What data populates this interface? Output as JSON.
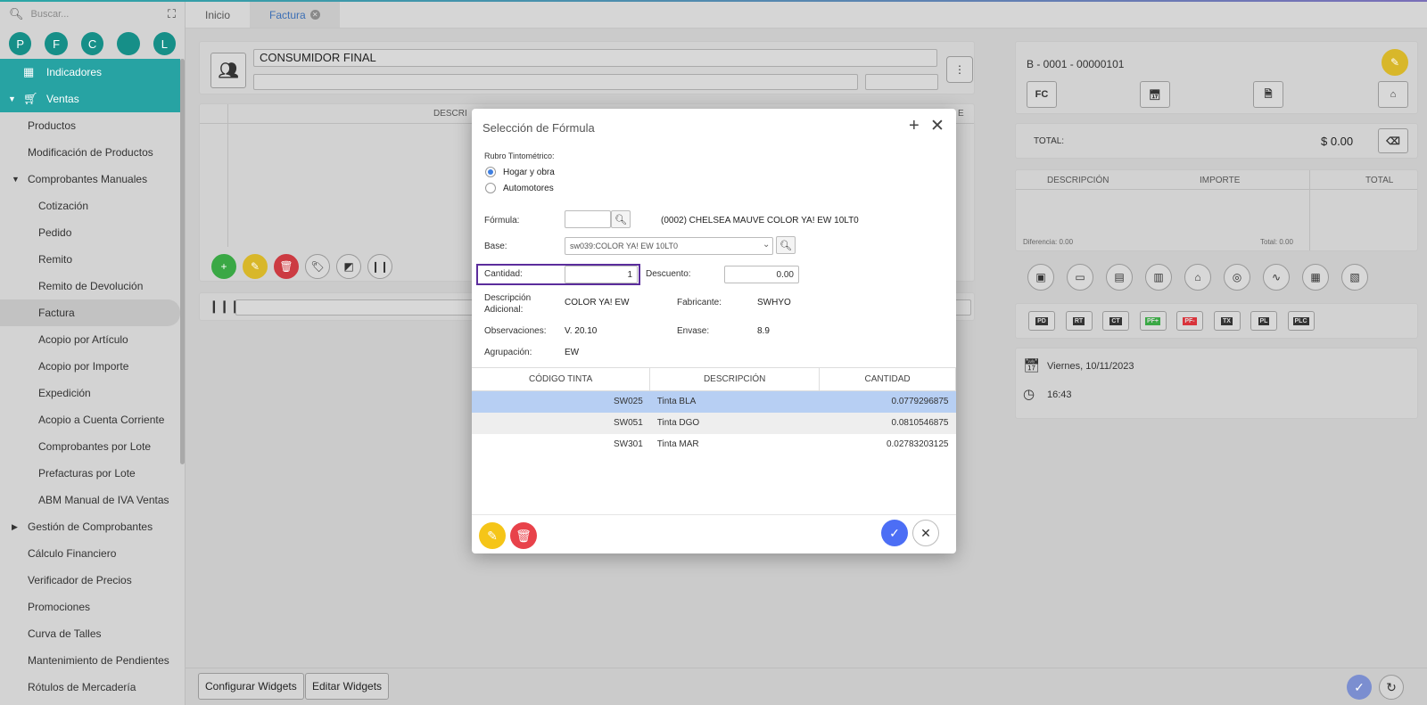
{
  "sidebar": {
    "search_placeholder": "Buscar...",
    "avatars": [
      "P",
      "F",
      "C",
      "",
      "L"
    ],
    "items": [
      {
        "label": "Indicadores",
        "level": 0,
        "style": "teal",
        "icon": "dashboard-icon"
      },
      {
        "label": "Ventas",
        "level": 0,
        "style": "teal",
        "icon": "cart-icon",
        "caret": "down"
      },
      {
        "label": "Productos",
        "level": 1
      },
      {
        "label": "Modificación de Productos",
        "level": 1
      },
      {
        "label": "Comprobantes Manuales",
        "level": 1,
        "caret": "down"
      },
      {
        "label": "Cotización",
        "level": 2
      },
      {
        "label": "Pedido",
        "level": 2
      },
      {
        "label": "Remito",
        "level": 2
      },
      {
        "label": "Remito de Devolución",
        "level": 2
      },
      {
        "label": "Factura",
        "level": 2,
        "style": "active"
      },
      {
        "label": "Acopio por Artículo",
        "level": 2
      },
      {
        "label": "Acopio por Importe",
        "level": 2
      },
      {
        "label": "Expedición",
        "level": 2
      },
      {
        "label": "Acopio a Cuenta Corriente",
        "level": 2
      },
      {
        "label": "Comprobantes por Lote",
        "level": 2
      },
      {
        "label": "Prefacturas por Lote",
        "level": 2
      },
      {
        "label": "ABM Manual de IVA Ventas",
        "level": 2
      },
      {
        "label": "Gestión de Comprobantes",
        "level": 1,
        "caret": "right"
      },
      {
        "label": "Cálculo Financiero",
        "level": 1
      },
      {
        "label": "Verificador de Precios",
        "level": 1
      },
      {
        "label": "Promociones",
        "level": 1
      },
      {
        "label": "Curva de Talles",
        "level": 1
      },
      {
        "label": "Mantenimiento de Pendientes",
        "level": 1
      },
      {
        "label": "Rótulos de Mercadería",
        "level": 1
      }
    ]
  },
  "tabs": {
    "inicio": "Inicio",
    "factura": "Factura"
  },
  "invoice": {
    "customer": "CONSUMIDOR FINAL",
    "grid_header": "DESCRI",
    "grid_header_right": "E",
    "number": "B - 0001 - 00000101",
    "fc": "FC",
    "total_label": "TOTAL:",
    "total_value": "$ 0.00",
    "pay_cols": [
      "DESCRIPCIÓN",
      "IMPORTE",
      "TOTAL"
    ],
    "diferencia": "Diferencia: 0.00",
    "total_small": "Total: 0.00",
    "doc_buttons": [
      "PD",
      "RT",
      "CT",
      "PF+",
      "PF-",
      "TX",
      "PL",
      "PLC"
    ],
    "date": "Viernes, 10/11/2023",
    "time": "16:43"
  },
  "footer": {
    "configure": "Configurar Widgets",
    "edit": "Editar Widgets"
  },
  "modal": {
    "title": "Selección de Fórmula",
    "rubro_label": "Rubro Tintométrico:",
    "rubro_options": [
      "Hogar y obra",
      "Automotores"
    ],
    "formula_label": "Fórmula:",
    "formula_value": "",
    "formula_desc": "(0002) CHELSEA MAUVE COLOR YA! EW 10LT0",
    "base_label": "Base:",
    "base_value": "sw039:COLOR YA! EW 10LT0",
    "cantidad_label": "Cantidad:",
    "cantidad_value": "1",
    "descuento_label": "Descuento:",
    "descuento_value": "0.00",
    "desc_adicional_label": "Descripción Adicional:",
    "desc_adicional_value": "COLOR YA! EW",
    "fabricante_label": "Fabricante:",
    "fabricante_value": "SWHYO",
    "observaciones_label": "Observaciones:",
    "observaciones_value": "V. 20.10",
    "envase_label": "Envase:",
    "envase_value": "8.9",
    "agrupacion_label": "Agrupación:",
    "agrupacion_value": "EW",
    "columns": [
      "CÓDIGO TINTA",
      "DESCRIPCIÓN",
      "CANTIDAD"
    ],
    "rows": [
      {
        "code": "SW025",
        "desc": "Tinta BLA",
        "qty": "0.0779296875"
      },
      {
        "code": "SW051",
        "desc": "Tinta DGO",
        "qty": "0.0810546875"
      },
      {
        "code": "SW301",
        "desc": "Tinta MAR",
        "qty": "0.02783203125"
      }
    ]
  },
  "colors": {
    "teal": "#27a3a3",
    "yellow": "#f5c518",
    "red": "#e8424a",
    "green": "#3aa845",
    "blue": "#4c6ef5",
    "highlight": "#5b2d9c"
  }
}
